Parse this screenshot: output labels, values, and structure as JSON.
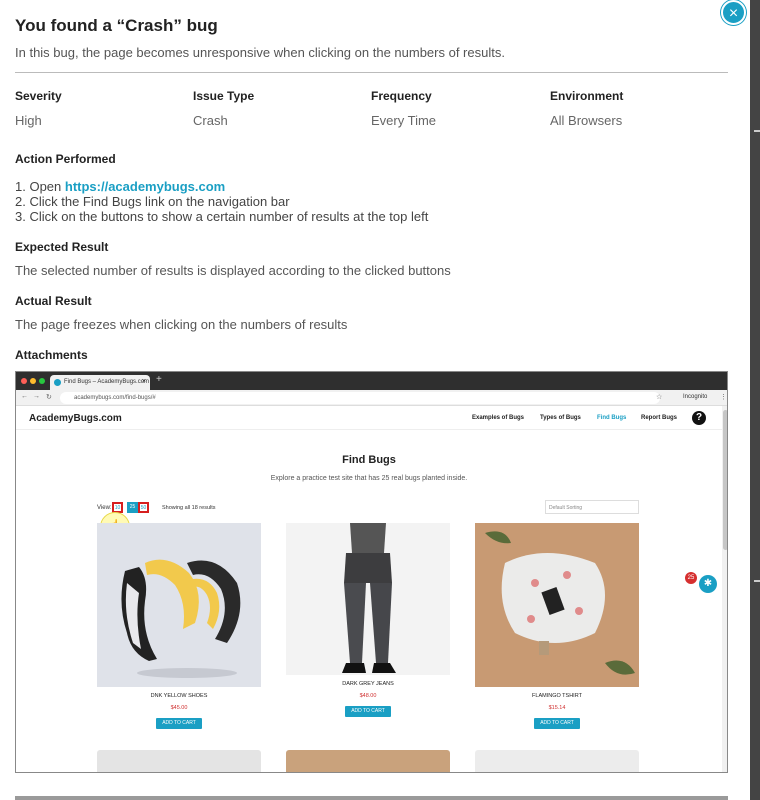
{
  "modal": {
    "close_symbol": "×",
    "title": "You found a “Crash” bug",
    "description": "In this bug, the page becomes unresponsive when clicking on the numbers of results."
  },
  "meta": [
    {
      "label": "Severity",
      "value": "High"
    },
    {
      "label": "Issue Type",
      "value": "Crash"
    },
    {
      "label": "Frequency",
      "value": "Every Time"
    },
    {
      "label": "Environment",
      "value": "All Browsers"
    }
  ],
  "action": {
    "heading": "Action Performed",
    "step1_prefix": "1. Open ",
    "step1_link": "https://academybugs.com",
    "step2": "2. Click the Find Bugs link on the navigation bar",
    "step3": "3. Click on the buttons to show a certain number of results at the top left"
  },
  "expected": {
    "heading": "Expected Result",
    "text": "The selected number of results is displayed according to the clicked buttons"
  },
  "actual": {
    "heading": "Actual Result",
    "text": "The page freezes when clicking on the numbers of results"
  },
  "attachments": {
    "heading": "Attachments",
    "shot": {
      "tab_title": "Find Bugs – AcademyBugs.com",
      "tab_close": "×",
      "new_tab": "+",
      "url": "academybugs.com/find-bugs/#",
      "incognito": "Incognito",
      "logo": "AcademyBugs.com",
      "nav": [
        "Examples of Bugs",
        "Types of Bugs",
        "Find Bugs",
        "Report Bugs"
      ],
      "help": "?",
      "page_title": "Find Bugs",
      "page_subtitle": "Explore a practice test site that has 25 real bugs planted inside.",
      "view_label": "View:",
      "view_options": [
        "10",
        "25",
        "50"
      ],
      "showing": "Showing all 18 results",
      "sort_placeholder": "Default Sorting",
      "bug_count": "25",
      "products": [
        {
          "name": "DNK YELLOW SHOES",
          "price": "$45.00",
          "cart": "ADD TO CART"
        },
        {
          "name": "DARK GREY JEANS",
          "price": "$48.00",
          "cart": "ADD TO CART"
        },
        {
          "name": "FLAMINGO TSHIRT",
          "price": "$15.14",
          "cart": "ADD TO CART"
        }
      ]
    }
  }
}
